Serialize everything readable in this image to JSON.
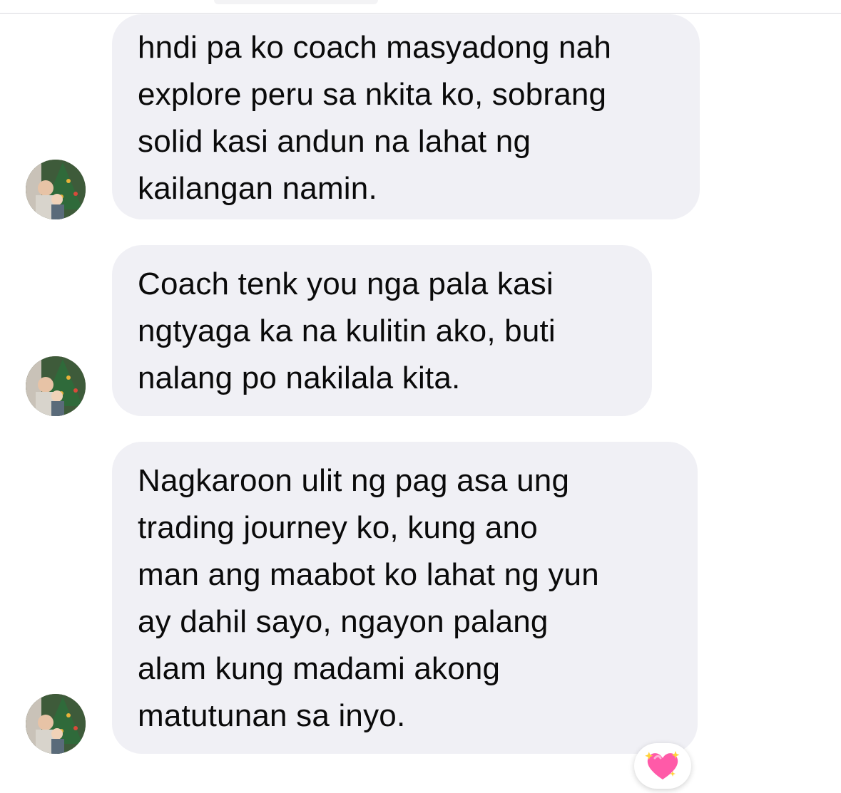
{
  "messages": [
    {
      "text": "hndi pa ko coach masyadong nah\nexplore peru sa nkita ko, sobrang\nsolid kasi andun na lahat ng\nkailangan namin."
    },
    {
      "text": "Coach tenk you nga pala kasi\nngtyaga ka na kulitin ako, buti\nnalang po nakilala kita."
    },
    {
      "text": "Nagkaroon ulit ng pag asa ung\ntrading journey ko, kung ano\nman ang maabot ko lahat ng yun\nay dahil sayo, ngayon palang\nalam kung madami akong\nmatutunan sa inyo."
    }
  ],
  "reaction": {
    "icon": "sparkling-heart-icon",
    "color": "#ff5aa8"
  },
  "colors": {
    "bubble": "#f0f0f5",
    "text": "#0a0a0a"
  }
}
